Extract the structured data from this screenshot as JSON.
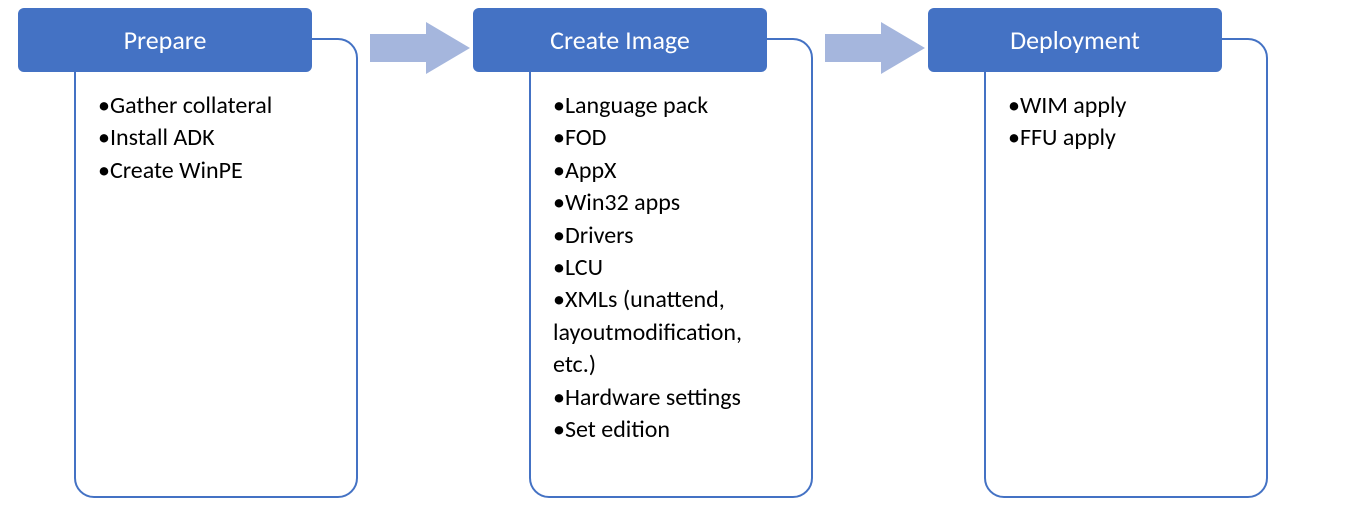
{
  "colors": {
    "header_bg": "#4472C4",
    "body_border": "#4472C4",
    "arrow_fill": "#A5B6DD"
  },
  "stages": [
    {
      "title": "Prepare",
      "items": [
        "Gather collateral",
        "Install ADK",
        "Create WinPE"
      ]
    },
    {
      "title": "Create Image",
      "items": [
        "Language pack",
        "FOD",
        "AppX",
        "Win32 apps",
        "Drivers",
        "LCU",
        "XMLs (unattend, layoutmodification, etc.)",
        "Hardware settings",
        "Set edition"
      ]
    },
    {
      "title": "Deployment",
      "items": [
        "WIM apply",
        "FFU apply"
      ]
    }
  ]
}
